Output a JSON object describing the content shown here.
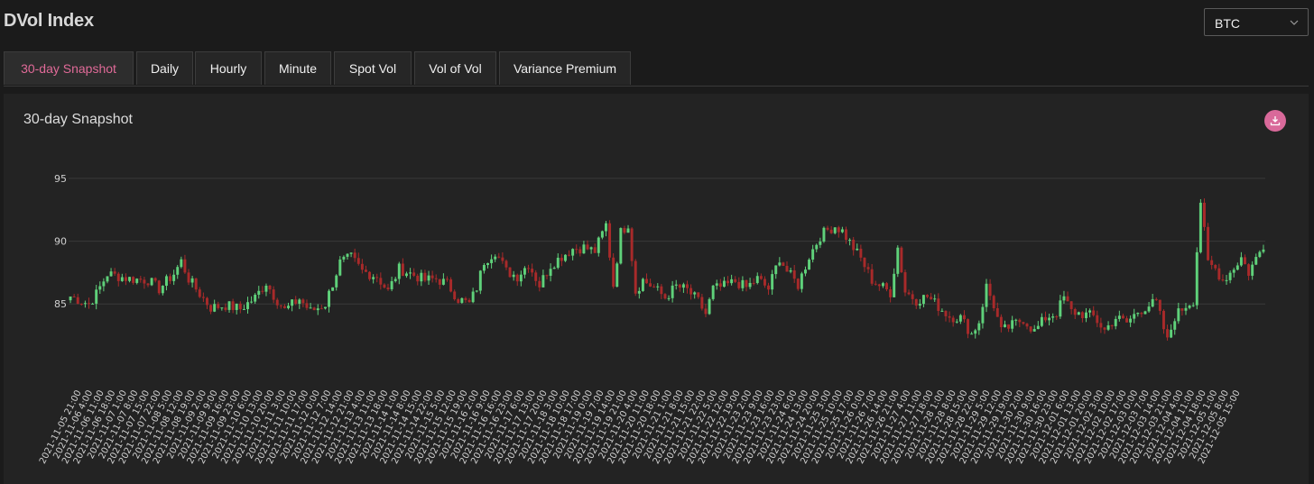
{
  "header": {
    "title": "DVol Index"
  },
  "asset_select": {
    "value": "BTC",
    "chevron_icon": "chevron-down-icon"
  },
  "tabs": [
    {
      "label": "30-day Snapshot",
      "active": true
    },
    {
      "label": "Daily"
    },
    {
      "label": "Hourly"
    },
    {
      "label": "Minute"
    },
    {
      "label": "Spot Vol"
    },
    {
      "label": "Vol of Vol"
    },
    {
      "label": "Variance Premium"
    }
  ],
  "panel": {
    "title": "30-day Snapshot",
    "download_icon": "download-icon"
  },
  "colors": {
    "accent": "#e06a98",
    "up": "#5fd17a",
    "down": "#a82a2a",
    "grid": "#3a3a3a"
  },
  "chart_data": {
    "type": "candlestick",
    "title": "30-day Snapshot",
    "ylim": [
      82,
      96
    ],
    "yticks": [
      85,
      90,
      95
    ],
    "grid": true,
    "x_tick_labels": [
      "2021-11-05 21:00",
      "2021-11-06 4:00",
      "2021-11-06 11:00",
      "2021-11-06 18:00",
      "2021-11-07 1:00",
      "2021-11-07 8:00",
      "2021-11-07 15:00",
      "2021-11-07 22:00",
      "2021-11-08 5:00",
      "2021-11-08 12:00",
      "2021-11-08 19:00",
      "2021-11-09 2:00",
      "2021-11-09 9:00",
      "2021-11-09 16:00",
      "2021-11-09 23:00",
      "2021-11-10 6:00",
      "2021-11-10 13:00",
      "2021-11-10 20:00",
      "2021-11-11 3:00",
      "2021-11-11 10:00",
      "2021-11-11 17:00",
      "2021-11-12 0:00",
      "2021-11-12 7:00",
      "2021-11-12 14:00",
      "2021-11-12 21:00",
      "2021-11-13 4:00",
      "2021-11-13 11:00",
      "2021-11-13 18:00",
      "2021-11-14 1:00",
      "2021-11-14 8:00",
      "2021-11-14 15:00",
      "2021-11-14 22:00",
      "2021-11-15 5:00",
      "2021-11-15 12:00",
      "2021-11-15 19:00",
      "2021-11-16 2:00",
      "2021-11-16 9:00",
      "2021-11-16 16:00",
      "2021-11-16 23:00",
      "2021-11-17 6:00",
      "2021-11-17 13:00",
      "2021-11-17 20:00",
      "2021-11-18 3:00",
      "2021-11-18 10:00",
      "2021-11-18 17:00",
      "2021-11-19 0:00",
      "2021-11-19 7:00",
      "2021-11-19 14:00",
      "2021-11-19 21:00",
      "2021-11-20 4:00",
      "2021-11-20 11:00",
      "2021-11-20 18:00",
      "2021-11-21 1:00",
      "2021-11-21 8:00",
      "2021-11-21 15:00",
      "2021-11-21 22:00",
      "2021-11-22 5:00",
      "2021-11-22 12:00",
      "2021-11-22 19:00",
      "2021-11-23 2:00",
      "2021-11-23 9:00",
      "2021-11-23 16:00",
      "2021-11-23 23:00",
      "2021-11-24 6:00",
      "2021-11-24 13:00",
      "2021-11-24 20:00",
      "2021-11-25 3:00",
      "2021-11-25 10:00",
      "2021-11-25 17:00",
      "2021-11-26 0:00",
      "2021-11-26 7:00",
      "2021-11-26 14:00",
      "2021-11-26 21:00",
      "2021-11-27 4:00",
      "2021-11-27 11:00",
      "2021-11-27 18:00",
      "2021-11-28 1:00",
      "2021-11-28 8:00",
      "2021-11-28 15:00",
      "2021-11-28 22:00",
      "2021-11-29 5:00",
      "2021-11-29 12:00",
      "2021-11-29 19:00",
      "2021-11-30 2:00",
      "2021-11-30 9:00",
      "2021-11-30 16:00",
      "2021-11-30 23:00",
      "2021-12-01 6:00",
      "2021-12-01 13:00",
      "2021-12-01 20:00",
      "2021-12-02 3:00",
      "2021-12-02 10:00",
      "2021-12-02 17:00",
      "2021-12-03 0:00",
      "2021-12-03 7:00",
      "2021-12-03 14:00",
      "2021-12-03 21:00",
      "2021-12-04 4:00",
      "2021-12-04 11:00",
      "2021-12-04 18:00",
      "2021-12-05 1:00",
      "2021-12-05 8:00",
      "2021-12-05 15:00"
    ],
    "close_path": [
      [
        0,
        85.6
      ],
      [
        5,
        85.0
      ],
      [
        7,
        85.8
      ],
      [
        10,
        87.4
      ],
      [
        16,
        87.0
      ],
      [
        21,
        86.9
      ],
      [
        24,
        86.2
      ],
      [
        28,
        87.4
      ],
      [
        30,
        88.4
      ],
      [
        32,
        87.0
      ],
      [
        35,
        85.8
      ],
      [
        38,
        84.7
      ],
      [
        42,
        84.9
      ],
      [
        46,
        84.6
      ],
      [
        50,
        85.5
      ],
      [
        53,
        86.7
      ],
      [
        55,
        85.7
      ],
      [
        58,
        84.5
      ],
      [
        62,
        85.4
      ],
      [
        65,
        84.4
      ],
      [
        69,
        85.0
      ],
      [
        73,
        88.3
      ],
      [
        76,
        88.7
      ],
      [
        79,
        87.6
      ],
      [
        83,
        87.2
      ],
      [
        86,
        86.0
      ],
      [
        89,
        87.8
      ],
      [
        93,
        87.3
      ],
      [
        96,
        86.9
      ],
      [
        99,
        87.0
      ],
      [
        102,
        86.6
      ],
      [
        105,
        85.4
      ],
      [
        108,
        85.0
      ],
      [
        110,
        86.3
      ],
      [
        112,
        88.4
      ],
      [
        115,
        89.2
      ],
      [
        118,
        87.6
      ],
      [
        121,
        87.2
      ],
      [
        124,
        88.2
      ],
      [
        127,
        86.5
      ],
      [
        130,
        88.1
      ],
      [
        133,
        88.8
      ],
      [
        136,
        89.4
      ],
      [
        139,
        89.5
      ],
      [
        142,
        89.2
      ],
      [
        145,
        91.3
      ],
      [
        147,
        86.5
      ],
      [
        149,
        90.7
      ],
      [
        151,
        91.4
      ],
      [
        153,
        86.0
      ],
      [
        155,
        86.9
      ],
      [
        158,
        86.3
      ],
      [
        161,
        85.5
      ],
      [
        164,
        86.4
      ],
      [
        167,
        86.1
      ],
      [
        170,
        85.2
      ],
      [
        172,
        84.2
      ],
      [
        174,
        86.2
      ],
      [
        177,
        86.4
      ],
      [
        180,
        86.8
      ],
      [
        183,
        86.3
      ],
      [
        186,
        87.0
      ],
      [
        189,
        86.2
      ],
      [
        192,
        88.7
      ],
      [
        194,
        87.6
      ],
      [
        197,
        86.5
      ],
      [
        200,
        88.8
      ],
      [
        203,
        90.4
      ],
      [
        205,
        90.9
      ],
      [
        207,
        91.2
      ],
      [
        209,
        90.8
      ],
      [
        211,
        89.9
      ],
      [
        214,
        88.6
      ],
      [
        217,
        86.9
      ],
      [
        220,
        86.3
      ],
      [
        222,
        85.9
      ],
      [
        224,
        89.5
      ],
      [
        226,
        86.0
      ],
      [
        229,
        85.3
      ],
      [
        232,
        85.6
      ],
      [
        235,
        84.8
      ],
      [
        238,
        84.0
      ],
      [
        241,
        83.9
      ],
      [
        244,
        82.6
      ],
      [
        246,
        83.6
      ],
      [
        248,
        86.4
      ],
      [
        250,
        84.9
      ],
      [
        252,
        82.8
      ],
      [
        255,
        83.3
      ],
      [
        258,
        83.8
      ],
      [
        261,
        82.8
      ],
      [
        264,
        83.9
      ],
      [
        267,
        84.3
      ],
      [
        269,
        85.5
      ],
      [
        271,
        84.4
      ],
      [
        274,
        84.2
      ],
      [
        277,
        84.0
      ],
      [
        280,
        82.9
      ],
      [
        283,
        83.9
      ],
      [
        286,
        83.5
      ],
      [
        289,
        84.4
      ],
      [
        292,
        84.9
      ],
      [
        294,
        85.1
      ],
      [
        297,
        82.0
      ],
      [
        299,
        84.0
      ],
      [
        302,
        84.9
      ],
      [
        304,
        85.3
      ],
      [
        306,
        93.2
      ],
      [
        308,
        88.2
      ],
      [
        310,
        87.8
      ],
      [
        312,
        86.9
      ],
      [
        314,
        87.5
      ],
      [
        317,
        88.7
      ],
      [
        319,
        87.5
      ],
      [
        321,
        88.6
      ],
      [
        323,
        89.7
      ]
    ]
  }
}
